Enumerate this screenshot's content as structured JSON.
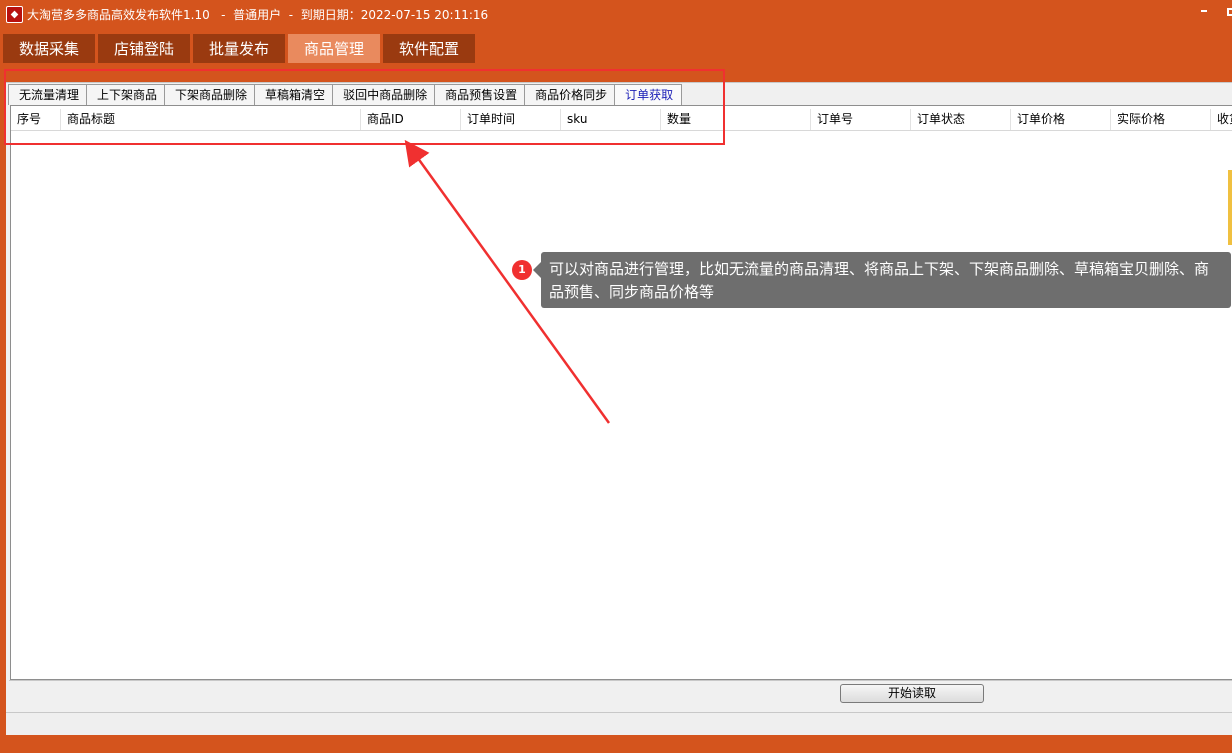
{
  "titlebar": {
    "title": "大淘营多多商品高效发布软件1.10   -  普通用户  -  到期日期：2022-07-15 20:11:16"
  },
  "main_tabs": [
    {
      "label": "数据采集"
    },
    {
      "label": "店铺登陆"
    },
    {
      "label": "批量发布"
    },
    {
      "label": "商品管理"
    },
    {
      "label": "软件配置"
    }
  ],
  "sub_tabs": [
    {
      "label": "无流量清理"
    },
    {
      "label": "上下架商品"
    },
    {
      "label": "下架商品删除"
    },
    {
      "label": "草稿箱清空"
    },
    {
      "label": "驳回中商品删除"
    },
    {
      "label": "商品预售设置"
    },
    {
      "label": "商品价格同步"
    },
    {
      "label": "订单获取"
    }
  ],
  "table": {
    "columns": [
      "序号",
      "商品标题",
      "商品ID",
      "订单时间",
      "sku",
      "数量",
      "订单号",
      "订单状态",
      "订单价格",
      "实际价格",
      "收货"
    ]
  },
  "start_button": {
    "label": "开始读取"
  },
  "callout": {
    "number": "1",
    "text": "可以对商品进行管理，比如无流量的商品清理、将商品上下架、下架商品删除、草稿箱宝贝删除、商品预售、同步商品价格等"
  },
  "colors": {
    "accent": "#D4541D",
    "active_tab": "#E98A5E",
    "highlight": "#F03030",
    "active_subtab_text": "#1E22B8"
  }
}
